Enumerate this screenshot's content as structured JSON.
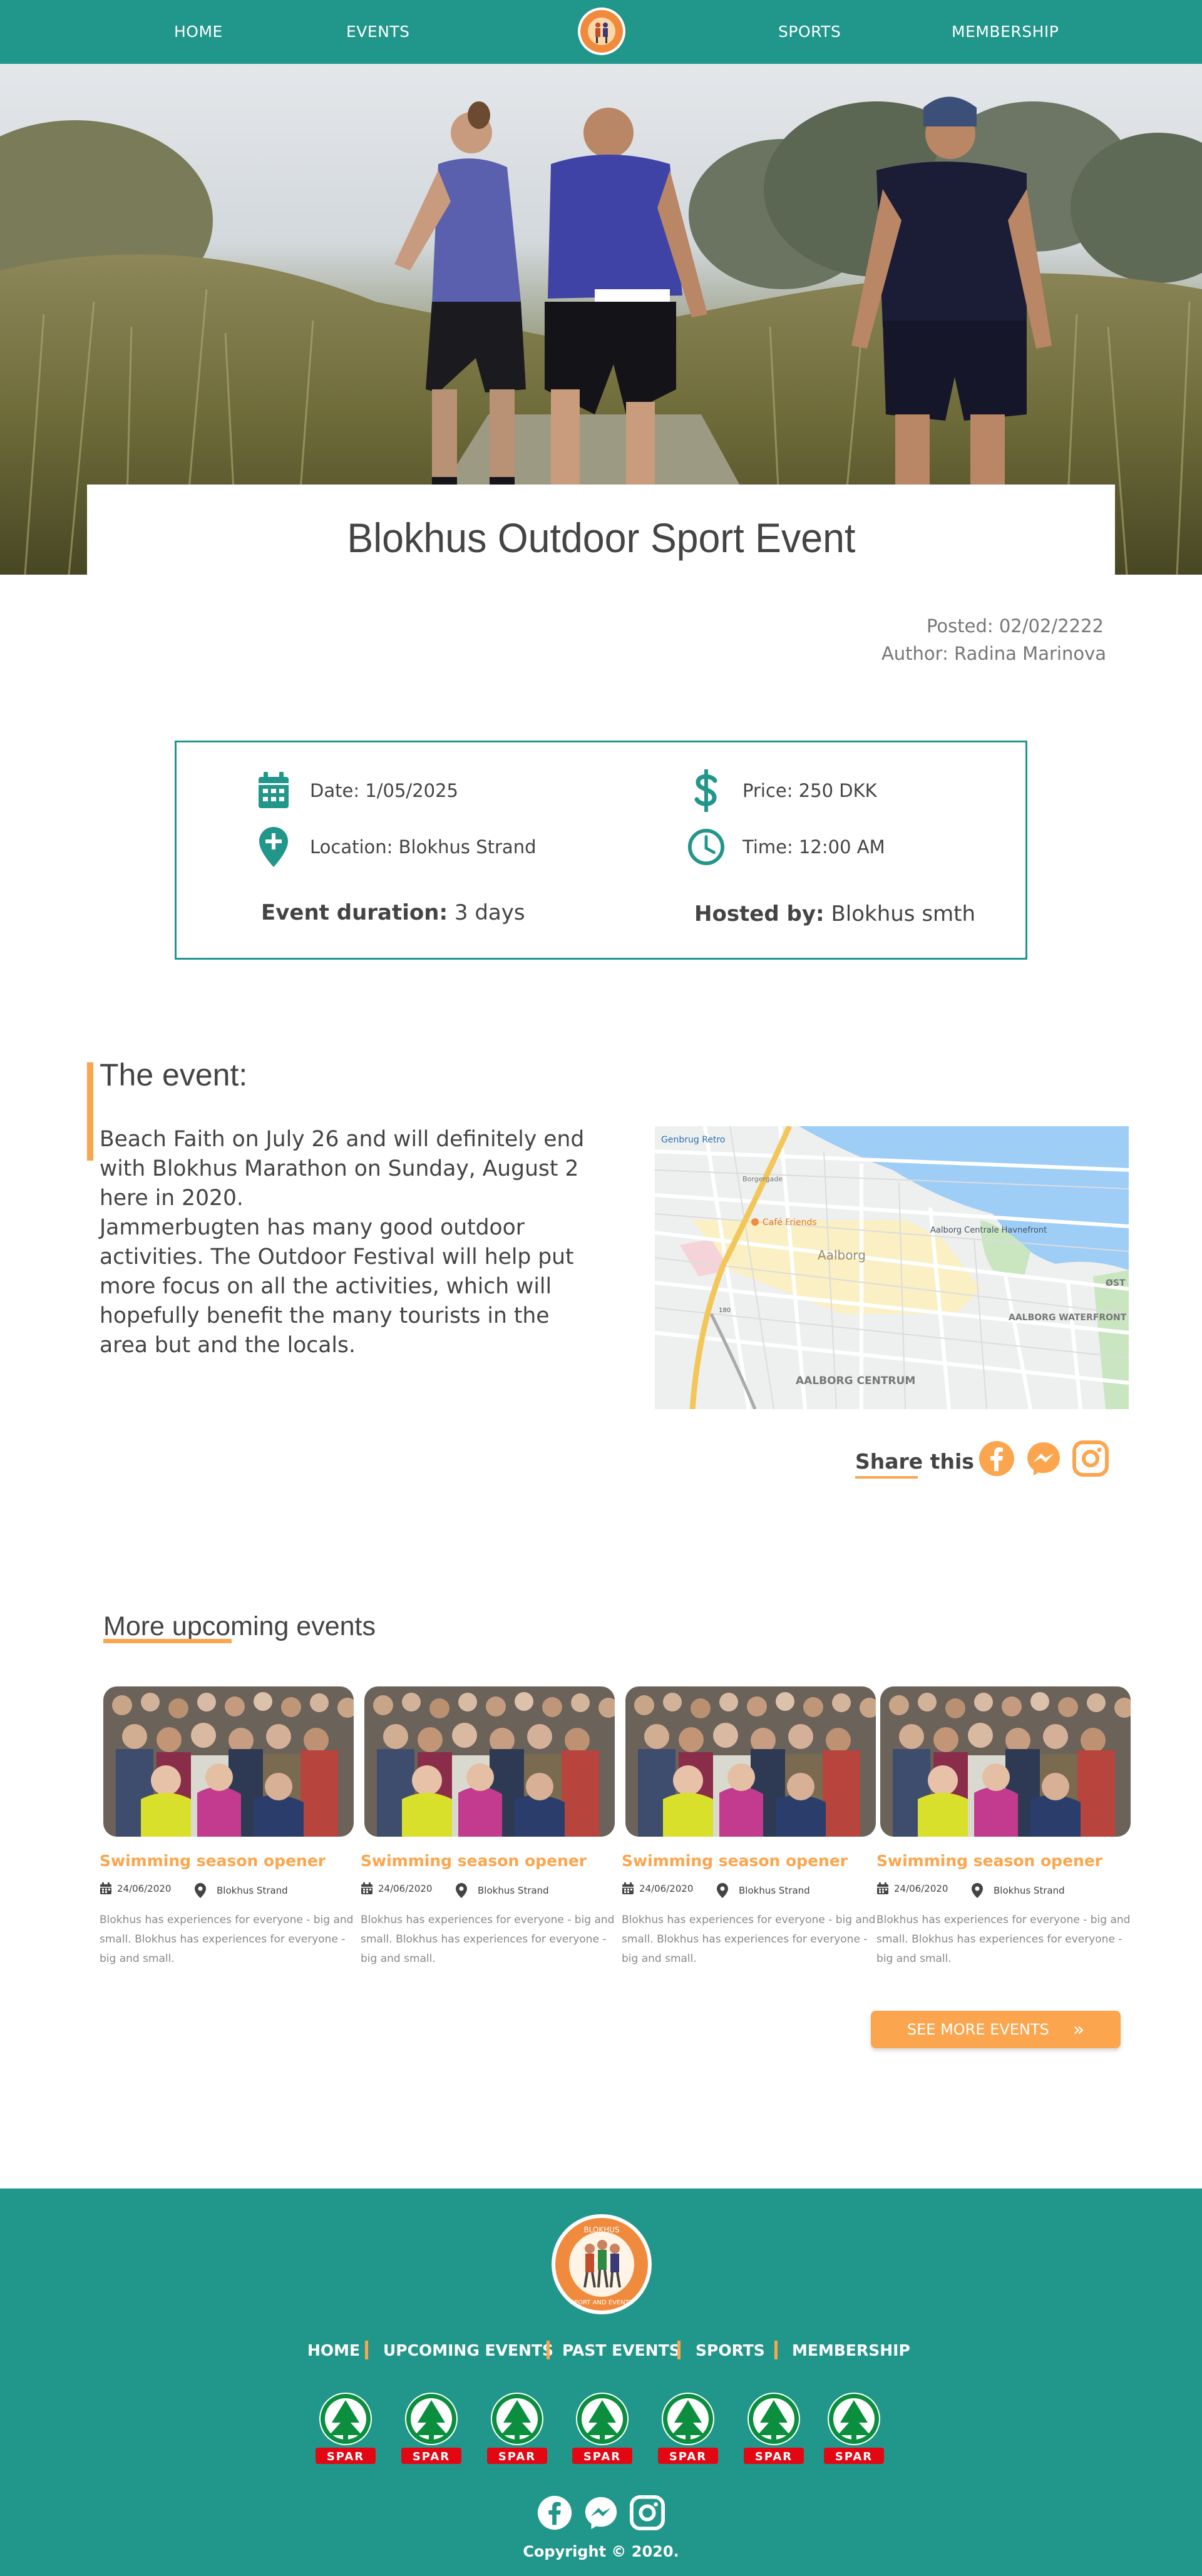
{
  "nav": {
    "items": [
      "HOME",
      "EVENTS",
      "SPORTS",
      "MEMBERSHIP"
    ],
    "logo_icon": "club-logo-icon"
  },
  "hero": {
    "title": "Blokhus Outdoor Sport Event"
  },
  "post": {
    "posted": "Posted: 02/02/2222",
    "author": "Author: Radina Marinova"
  },
  "info": {
    "date": "Date: 1/05/2025",
    "location": "Location: Blokhus Strand",
    "price": "Price: 250 DKK",
    "time": "Time: 12:00 AM",
    "duration_label": "Event duration:",
    "duration_value": " 3 days",
    "hosted_label": "Hosted by:",
    "hosted_value": " Blokhus smth"
  },
  "event": {
    "heading": "The event:",
    "body": "Beach Faith on July 26 and will definitely end with Blokhus Marathon on Sunday, August 2 here in 2020.\nJammerbugten has many good outdoor activities. The Outdoor Festival will help put more focus on all the activities, which will hopefully benefit the many tourists in the area but and the locals."
  },
  "map": {
    "labels": [
      "Genbrug Retro",
      "Borgergade",
      "Café Friends",
      "Aalborg",
      "Aalborg Centrale Havnefront",
      "AALBORG WATERFRONT",
      "AALBORG CENTRUM",
      "ØST",
      "180"
    ]
  },
  "share": {
    "label": "Share this",
    "icons": [
      "facebook-icon",
      "messenger-icon",
      "instagram-icon"
    ]
  },
  "more": {
    "heading": "More upcoming events",
    "cards": [
      {
        "title": "Swimming season opener",
        "date": "24/06/2020",
        "location": "Blokhus Strand",
        "desc": "Blokhus has experiences for everyone - big and small. Blokhus has experiences for everyone - big and small."
      },
      {
        "title": "Swimming season opener",
        "date": "24/06/2020",
        "location": "Blokhus Strand",
        "desc": "Blokhus has experiences for everyone - big and small. Blokhus has experiences for everyone - big and small."
      },
      {
        "title": "Swimming season opener",
        "date": "24/06/2020",
        "location": "Blokhus Strand",
        "desc": "Blokhus has experiences for everyone - big and small. Blokhus has experiences for everyone - big and small."
      },
      {
        "title": "Swimming season opener",
        "date": "24/06/2020",
        "location": "Blokhus Strand",
        "desc": "Blokhus has experiences for everyone - big and small. Blokhus has experiences for everyone - big and small."
      }
    ],
    "see_more": "SEE MORE EVENTS"
  },
  "footer": {
    "links": [
      "HOME",
      "UPCOMING EVENTS",
      "PAST EVENTS",
      "SPORTS",
      "MEMBERSHIP"
    ],
    "sponsor_text": "SPAR",
    "logo_text_top": "BLOKHUS",
    "logo_text_bottom": "SPORT AND EVENTS",
    "copyright": "Copyright © 2020."
  },
  "colors": {
    "teal": "#21968a",
    "orange": "#fba64f",
    "text": "#444444",
    "spar_green": "#0b8f3f",
    "spar_red": "#e30613"
  }
}
